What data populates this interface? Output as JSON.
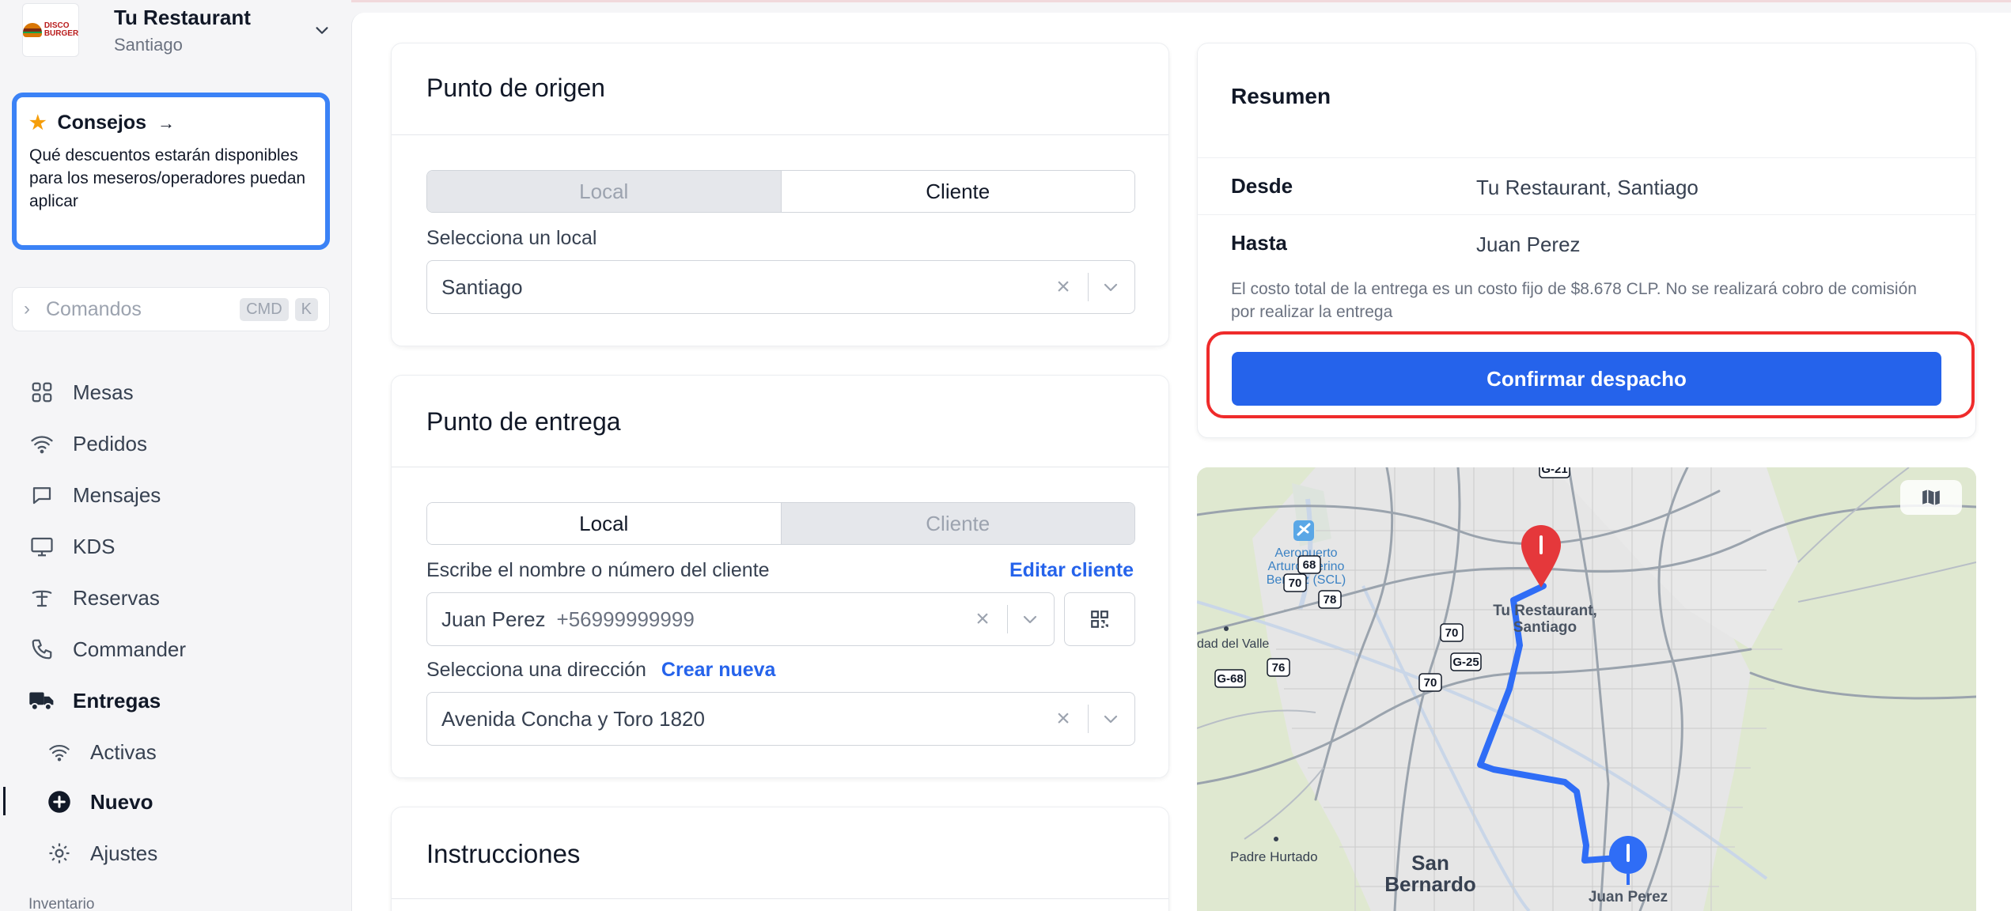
{
  "restaurant": {
    "name": "Tu Restaurant",
    "city": "Santiago",
    "logo_text_1": "DISCO",
    "logo_text_2": "BURGER"
  },
  "tips": {
    "title": "Consejos",
    "text": "Qué descuentos estarán disponibles para los meseros/operadores puedan aplicar"
  },
  "commands": {
    "label": "Comandos",
    "key1": "CMD",
    "key2": "K"
  },
  "nav": {
    "mesas": "Mesas",
    "pedidos": "Pedidos",
    "mensajes": "Mensajes",
    "kds": "KDS",
    "reservas": "Reservas",
    "commander": "Commander",
    "entregas": "Entregas",
    "activas": "Activas",
    "nuevo": "Nuevo",
    "ajustes": "Ajustes",
    "inventario": "Inventario"
  },
  "origin": {
    "title": "Punto de origen",
    "seg_local": "Local",
    "seg_cliente": "Cliente",
    "selected_segment": "Cliente",
    "select_label": "Selecciona un local",
    "select_value": "Santiago"
  },
  "delivery": {
    "title": "Punto de entrega",
    "seg_local": "Local",
    "seg_cliente": "Cliente",
    "selected_segment": "Local",
    "client_label": "Escribe el nombre o número del cliente",
    "edit_client": "Editar cliente",
    "client_name": "Juan Perez",
    "client_phone": "+56999999999",
    "address_label": "Selecciona una dirección",
    "create_new": "Crear nueva",
    "address_value": "Avenida Concha y Toro 1820"
  },
  "instructions": {
    "title": "Instrucciones"
  },
  "summary": {
    "title": "Resumen",
    "from_label": "Desde",
    "from_value": "Tu Restaurant, Santiago",
    "to_label": "Hasta",
    "to_value": "Juan Perez",
    "note": "El costo total de la entrega es un costo fijo de $8.678 CLP. No se realizará cobro de comisión por realizar la entrega",
    "confirm": "Confirmar despacho"
  },
  "map": {
    "airport": [
      "Aeropuerto",
      "Arturo Merino",
      "Benítez (SCL)"
    ],
    "origin_label": [
      "Tu Restaurant,",
      "Santiago"
    ],
    "dest_label": "Juan Perez",
    "places": {
      "valle": "dad del Valle",
      "padre": "Padre Hurtado",
      "sanb1": "San",
      "sanb2": "Bernardo"
    },
    "shields": [
      "G-21",
      "68",
      "70",
      "78",
      "70",
      "G-25",
      "76",
      "G-68",
      "70"
    ],
    "origin_pin_color": "#e5383b",
    "dest_pin_color": "#2f6df6",
    "route_color": "#2f6df6"
  },
  "colors": {
    "accent": "#2563eb",
    "highlight": "#ef2b2b",
    "tips_border": "#3b82f6"
  }
}
